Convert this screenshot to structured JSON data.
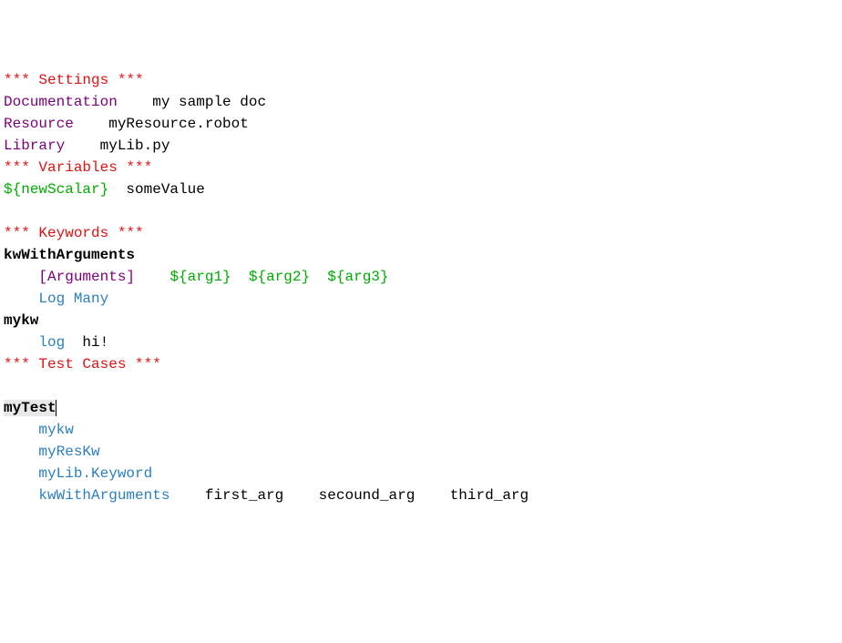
{
  "lines": {
    "l1_settings_header": "*** Settings ***",
    "l2_doc_key": "Documentation",
    "l2_doc_val": "my sample doc",
    "l3_res_key": "Resource",
    "l3_res_val": "myResource.robot",
    "l4_lib_key": "Library",
    "l4_lib_val": "myLib.py",
    "l5_variables_header": "*** Variables ***",
    "l6_var_name": "${newScalar}",
    "l6_var_val": "someValue",
    "l7_blank": "",
    "l8_keywords_header": "*** Keywords ***",
    "l9_kw1_name": "kwWithArguments",
    "l10_indent": "    ",
    "l10_args_tag": "[Arguments]",
    "l10_sep": "    ",
    "l10_arg1": "${arg1}",
    "l10_space2": "  ",
    "l10_arg2": "${arg2}",
    "l10_space3": "  ",
    "l10_arg3": "${arg3}",
    "l11_indent": "    ",
    "l11_logmany": "Log Many",
    "l12_kw2_name": "mykw",
    "l13_indent": "    ",
    "l13_log": "log",
    "l13_sp": "  ",
    "l13_hi": "hi!",
    "l14_testcases_header": "*** Test Cases ***",
    "l15_blank": "",
    "l16_test_name": "myTest",
    "l17_indent": "    ",
    "l17_call": "mykw",
    "l18_indent": "    ",
    "l18_call": "myResKw",
    "l19_indent": "    ",
    "l19_call": "myLib.Keyword",
    "l20_indent": "    ",
    "l20_call": "kwWithArguments",
    "l20_s1": "    ",
    "l20_a1": "first_arg",
    "l20_s2": "    ",
    "l20_a2": "secound_arg",
    "l20_s3": "    ",
    "l20_a3": "third_arg"
  }
}
